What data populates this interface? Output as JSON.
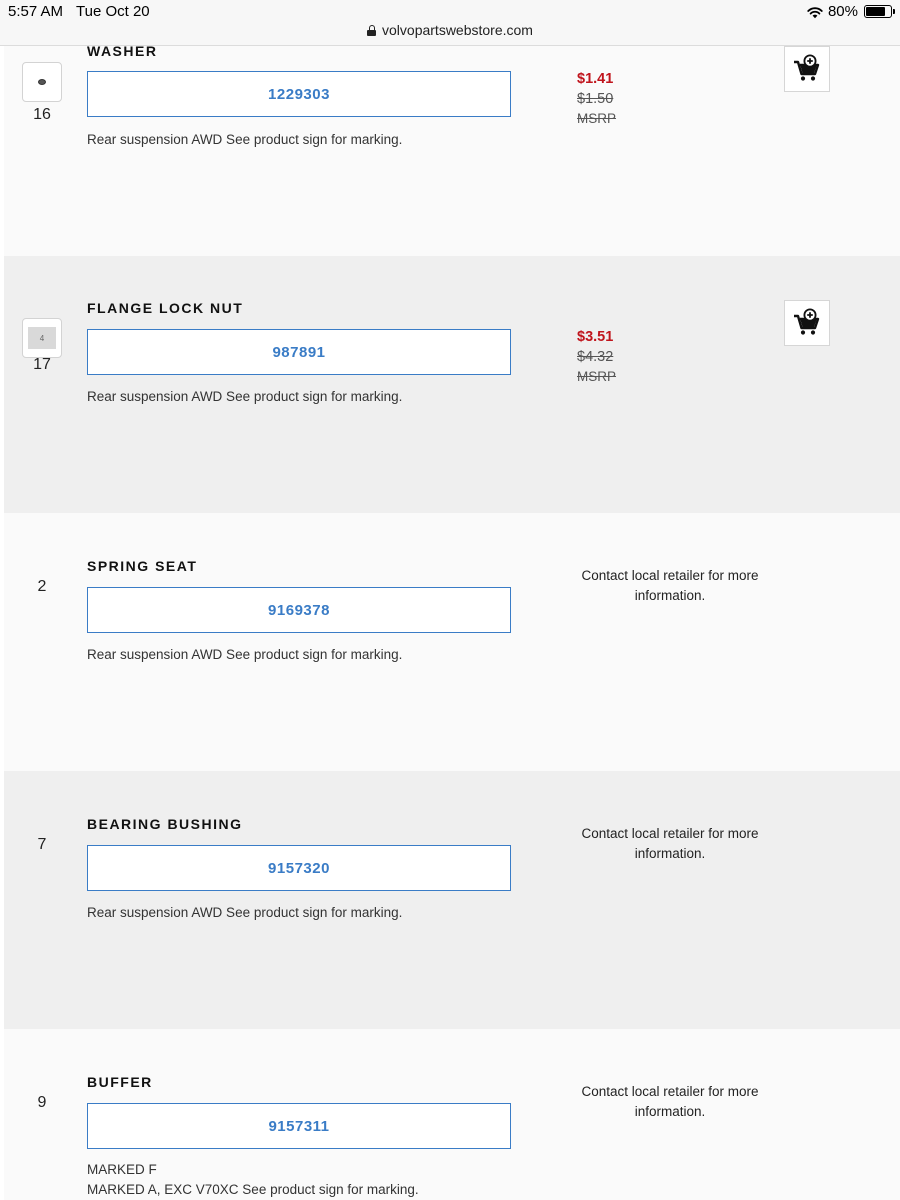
{
  "status_bar": {
    "time": "5:57 AM",
    "date": "Tue Oct 20",
    "battery": "80%",
    "battery_level": 0.8,
    "url": "volvopartswebstore.com",
    "icons": [
      "wifi-icon",
      "battery-icon",
      "lock-icon"
    ]
  },
  "parts": [
    {
      "name": "WASHER",
      "item_number": "16",
      "part_number": "1229303",
      "description": "Rear suspension AWD See product sign for marking.",
      "sale_price": "$1.41",
      "original_price": "$1.50",
      "msrp_label": "MSRP",
      "has_thumbnail": true,
      "has_cart": true
    },
    {
      "name": "FLANGE LOCK NUT",
      "item_number": "17",
      "part_number": "987891",
      "description": "Rear suspension AWD See product sign for marking.",
      "sale_price": "$3.51",
      "original_price": "$4.32",
      "msrp_label": "MSRP",
      "thumbnail_text": "4",
      "has_thumbnail": true,
      "has_cart": true
    },
    {
      "name": "SPRING SEAT",
      "item_number": "2",
      "part_number": "9169378",
      "description": "Rear suspension AWD See product sign for marking.",
      "contact_line1": "Contact local retailer for more",
      "contact_line2": "information."
    },
    {
      "name": "BEARING BUSHING",
      "item_number": "7",
      "part_number": "9157320",
      "description": "Rear suspension AWD See product sign for marking.",
      "contact_line1": "Contact local retailer for more",
      "contact_line2": "information."
    },
    {
      "name": "BUFFER",
      "item_number": "9",
      "part_number": "9157311",
      "description_line1": "MARKED F",
      "description_line2": "MARKED A, EXC V70XC See product sign for marking.",
      "contact_line1": "Contact local retailer for more",
      "contact_line2": "information."
    }
  ],
  "colors": {
    "accent_blue": "#3a7cc6",
    "sale_red": "#c0141c",
    "row_gray": "#efefef",
    "row_light": "#fafafa"
  }
}
